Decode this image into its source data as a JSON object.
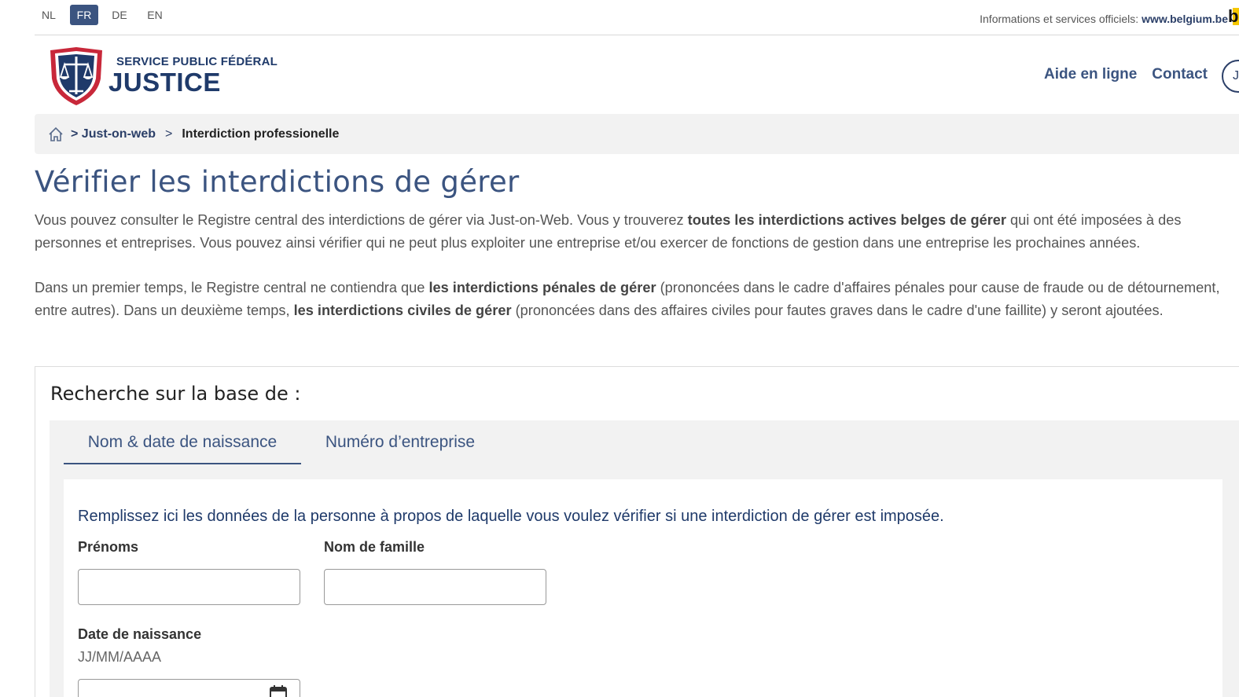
{
  "langs": [
    {
      "code": "NL",
      "active": false
    },
    {
      "code": "FR",
      "active": true
    },
    {
      "code": "DE",
      "active": false
    },
    {
      "code": "EN",
      "active": false
    }
  ],
  "belgium": {
    "text": "Informations et services officiels:",
    "link": "www.belgium.be",
    "logo_letter": "b"
  },
  "brand": {
    "sub": "SERVICE PUBLIC FÉDÉRAL",
    "main": "JUSTICE"
  },
  "nav": {
    "help": "Aide en ligne",
    "contact": "Contact",
    "user_initial": "J"
  },
  "breadcrumb": {
    "link": "> Just-on-web",
    "sep": ">",
    "current": "Interdiction professionelle"
  },
  "page": {
    "title": "Vérifier les interdictions de gérer",
    "p1_a": "Vous pouvez consulter le Registre central des interdictions de gérer via Just-on-Web. Vous y trouverez ",
    "p1_b": "toutes les interdictions actives belges de gérer",
    "p1_c": " qui ont été imposées à des personnes et entreprises. Vous pouvez ainsi vérifier qui ne peut plus exploiter une entreprise et/ou exercer de fonctions de gestion dans une entreprise les prochaines années.",
    "p2_a": "Dans un premier temps, le Registre central ne contiendra que ",
    "p2_b": "les interdictions pénales de gérer",
    "p2_c": " (prononcées dans le cadre d'affaires pénales pour cause de fraude ou de détournement, entre autres). Dans un deuxième temps, ",
    "p2_d": "les interdictions civiles de gérer",
    "p2_e": " (prononcées dans des affaires civiles pour fautes graves dans le cadre d'une faillite) y seront ajoutées."
  },
  "search": {
    "heading": "Recherche sur la base de :",
    "tabs": [
      "Nom & date de naissance",
      "Numéro d’entreprise"
    ],
    "intro": "Remplissez ici les données de la personne à propos de laquelle vous voulez vérifier si une interdiction de gérer est imposée.",
    "first_name_label": "Prénoms",
    "first_name_value": "",
    "last_name_label": "Nom de famille",
    "last_name_value": "",
    "birth_label": "Date de naissance",
    "birth_hint": "JJ/MM/AAAA",
    "birth_value": ""
  },
  "colors": {
    "accent": "#3b5480",
    "brand": "#1f3a6a",
    "belgium_yellow": "#f5c700"
  }
}
